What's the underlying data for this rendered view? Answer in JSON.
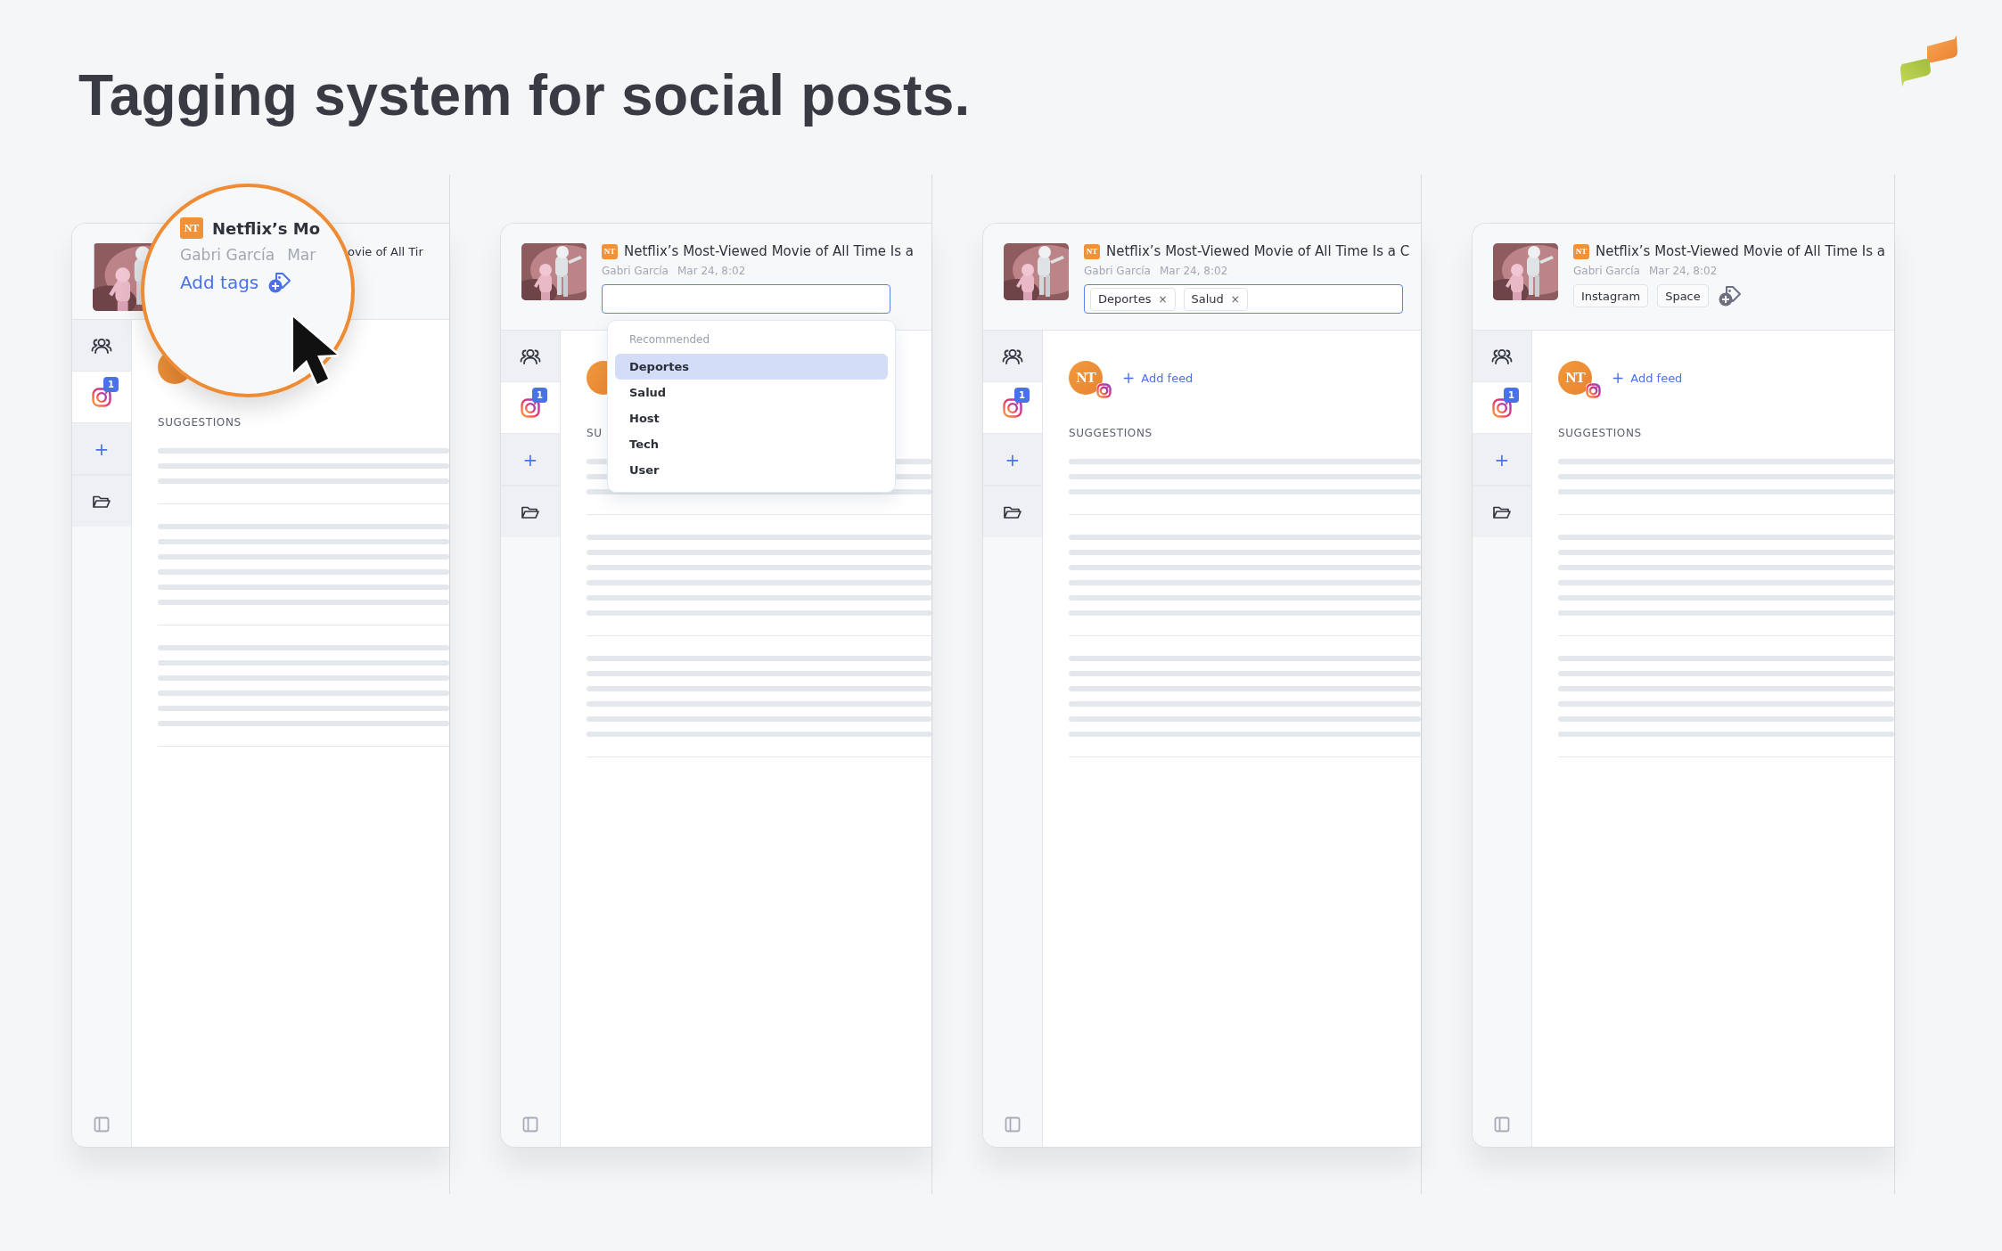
{
  "heading": "Tagging system for social posts.",
  "panels": [
    {
      "kind": "magnified",
      "title": "ovie of All Tir",
      "suggestions_label": "SUGGESTIONS",
      "sidebar": [
        {
          "kind": "people",
          "selected": false
        },
        {
          "kind": "instagram",
          "selected": true,
          "badge": "1"
        },
        {
          "kind": "add",
          "label": "+",
          "selected": false
        },
        {
          "kind": "folder",
          "selected": false
        }
      ],
      "magnifier": {
        "source_logo": "NT",
        "title": "Netflix’s Mo",
        "author": "Gabri García",
        "date": "Mar",
        "add_tags": "Add tags"
      }
    },
    {
      "kind": "dropdown",
      "source_logo": "NT",
      "title": "Netflix’s Most-Viewed Movie of All Time Is a",
      "author": "Gabri García",
      "date": "Mar 24, 8:02",
      "suggestions_label": "SU",
      "sidebar": [
        {
          "kind": "people",
          "selected": false
        },
        {
          "kind": "instagram",
          "selected": true,
          "badge": "1"
        },
        {
          "kind": "add",
          "label": "+",
          "selected": false
        },
        {
          "kind": "folder",
          "selected": false
        }
      ],
      "tag_input": {
        "focused": true
      },
      "dropdown": {
        "heading": "Recommended",
        "options": [
          {
            "label": "Deportes",
            "selected": true
          },
          {
            "label": "Salud",
            "selected": false
          },
          {
            "label": "Host",
            "selected": false
          },
          {
            "label": "Tech",
            "selected": false
          },
          {
            "label": "User",
            "selected": false
          }
        ]
      }
    },
    {
      "kind": "tag_input",
      "source_logo": "NT",
      "title": "Netflix’s Most-Viewed Movie of All Time Is a C",
      "author": "Gabri García",
      "date": "Mar 24, 8:02",
      "avatar_text": "NT",
      "add_feed": "Add feed",
      "add_feed_icon": "+",
      "suggestions_label": "SUGGESTIONS",
      "sidebar": [
        {
          "kind": "people",
          "selected": false
        },
        {
          "kind": "instagram",
          "selected": true,
          "badge": "1"
        },
        {
          "kind": "add",
          "label": "+",
          "selected": false
        },
        {
          "kind": "folder",
          "selected": false
        }
      ],
      "tag_input": {
        "focused": true,
        "tags": [
          {
            "label": "Deportes",
            "remove": "×"
          },
          {
            "label": "Salud",
            "remove": "×"
          }
        ]
      }
    },
    {
      "kind": "tag_list",
      "source_logo": "NT",
      "title": "Netflix’s Most-Viewed Movie of All Time Is a",
      "author": "Gabri García",
      "date": "Mar 24, 8:02",
      "avatar_text": "NT",
      "add_feed": "Add feed",
      "add_feed_icon": "+",
      "suggestions_label": "SUGGESTIONS",
      "sidebar": [
        {
          "kind": "people",
          "selected": false
        },
        {
          "kind": "instagram",
          "selected": true,
          "badge": "1"
        },
        {
          "kind": "add",
          "label": "+",
          "selected": false
        },
        {
          "kind": "folder",
          "selected": false
        }
      ],
      "tags": [
        {
          "label": "Instagram"
        },
        {
          "label": "Space"
        }
      ]
    }
  ]
}
